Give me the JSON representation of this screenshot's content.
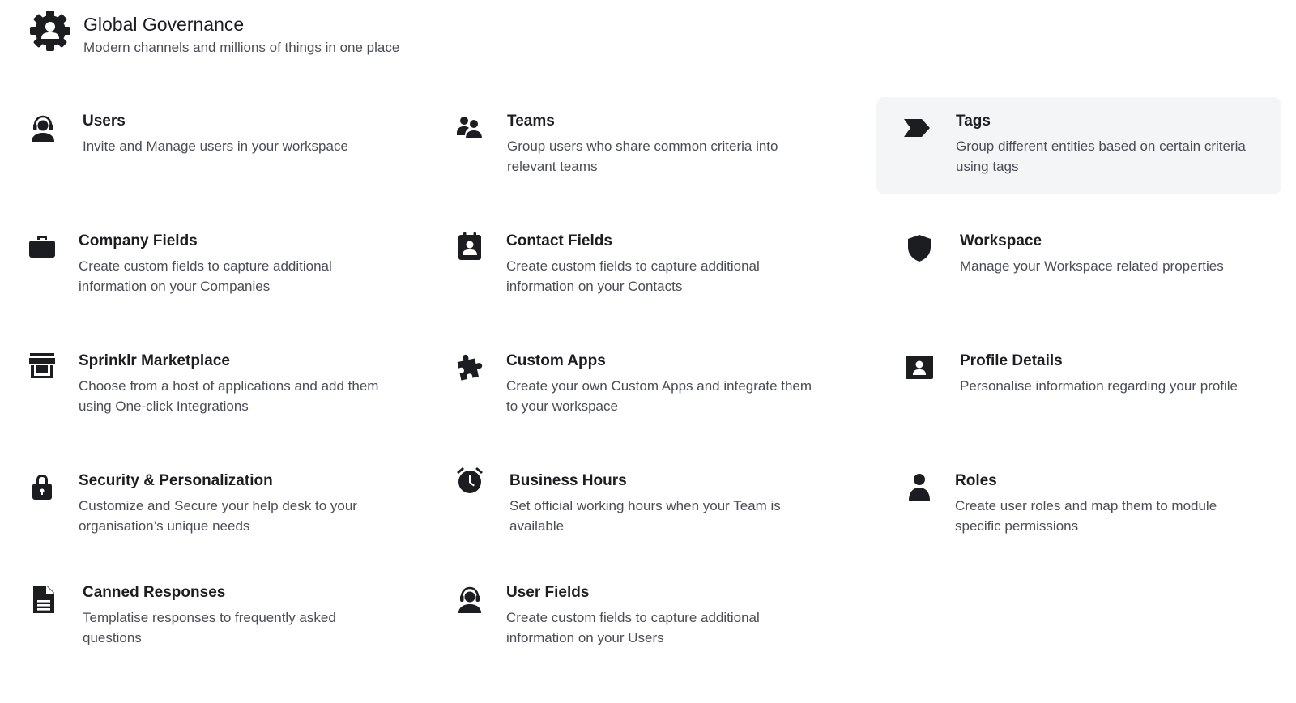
{
  "header": {
    "title": "Global Governance",
    "subtitle": "Modern channels and millions of things in one place",
    "icon": "gear-person-icon"
  },
  "cards": [
    {
      "name": "Users",
      "description": "Invite and Manage users in your workspace",
      "icon": "agent-headset-icon"
    },
    {
      "name": "Teams",
      "description": "Group users who share common criteria into relevant teams",
      "icon": "teams-icon"
    },
    {
      "name": "Tags",
      "description": "Group different entities based on certain criteria using tags",
      "icon": "tag-icon",
      "highlighted": true
    },
    {
      "name": "Company Fields",
      "description": "Create custom fields to capture additional information on your Companies",
      "icon": "briefcase-icon"
    },
    {
      "name": "Contact Fields",
      "description": "Create custom fields to capture additional information on your Contacts",
      "icon": "contact-card-icon"
    },
    {
      "name": "Workspace",
      "description": "Manage your Workspace related properties",
      "icon": "shield-icon"
    },
    {
      "name": "Sprinklr Marketplace",
      "description": "Choose from a host of applications and add them using One-click Integrations",
      "icon": "store-icon"
    },
    {
      "name": "Custom Apps",
      "description": "Create your own Custom Apps and integrate them to your workspace",
      "icon": "puzzle-icon"
    },
    {
      "name": "Profile Details",
      "description": "Personalise information regarding your profile",
      "icon": "id-card-icon"
    },
    {
      "name": "Security & Personalization",
      "description": "Customize and Secure your help desk to your organisation’s unique needs",
      "icon": "lock-icon"
    },
    {
      "name": "Business Hours",
      "description": "Set official working hours when your Team is available",
      "icon": "alarm-clock-icon"
    },
    {
      "name": "Roles",
      "description": "Create user roles and map them to module specific permissions",
      "icon": "person-icon"
    },
    {
      "name": "Canned Responses",
      "description": "Templatise responses to frequently asked questions",
      "icon": "document-icon"
    },
    {
      "name": "User Fields",
      "description": "Create custom fields to capture additional information on your Users",
      "icon": "agent-headset-icon"
    }
  ],
  "colors": {
    "text_primary": "#1c1d21",
    "text_secondary": "#4a4d55",
    "highlight_bg": "#f4f5f7"
  }
}
